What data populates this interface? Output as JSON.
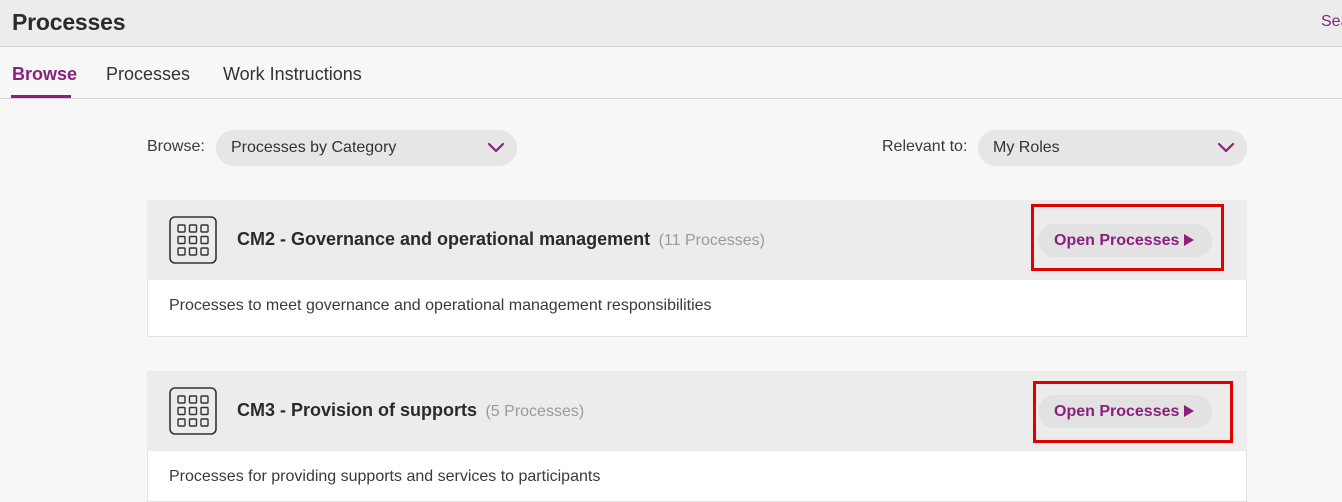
{
  "header": {
    "title": "Processes",
    "search_link": "Sea"
  },
  "tabs": [
    {
      "label": "Browse",
      "active": true
    },
    {
      "label": "Processes",
      "active": false
    },
    {
      "label": "Work Instructions",
      "active": false
    }
  ],
  "filters": {
    "browse_label": "Browse:",
    "browse_value": "Processes by Category",
    "relevant_label": "Relevant to:",
    "relevant_value": "My Roles"
  },
  "categories": [
    {
      "name": "CM2 - Governance and operational management",
      "count": "(11 Processes)",
      "description": "Processes to meet governance and operational management responsibilities",
      "button_label": "Open Processes"
    },
    {
      "name": "CM3 - Provision of supports",
      "count": "(5 Processes)",
      "description": "Processes for providing supports and services to participants",
      "button_label": "Open Processes"
    }
  ],
  "icons": {
    "category": "grid-icon",
    "dropdown": "chevron-down-icon",
    "open": "play-arrow-icon"
  },
  "colors": {
    "accent": "#8c1f7e",
    "highlight": "#e00000"
  }
}
